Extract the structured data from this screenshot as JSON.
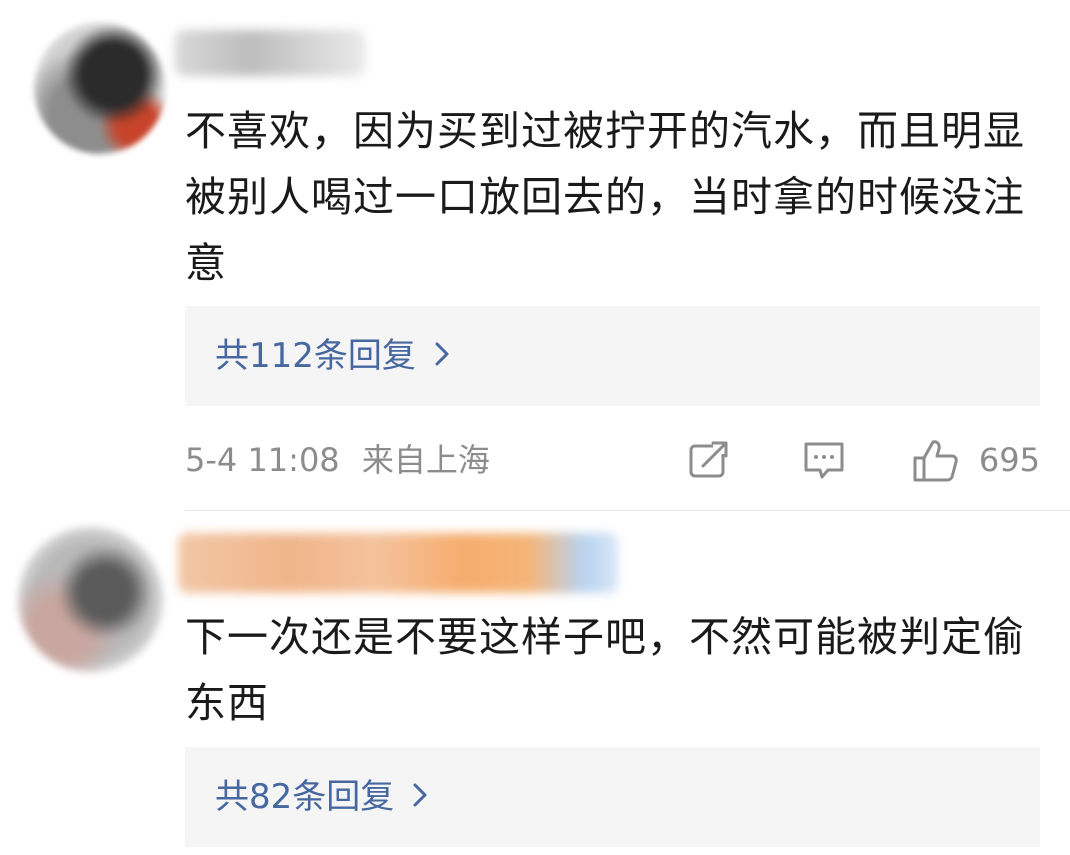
{
  "comments": [
    {
      "text": "不喜欢，因为买到过被拧开的汽水，而且明显被别人喝过一口放回去的，当时拿的时候没注意",
      "replies_label": "共112条回复",
      "timestamp": "5-4 11:08",
      "location": "来自上海",
      "likes": "695"
    },
    {
      "text": "下一次还是不要这样子吧，不然可能被判定偷东西",
      "replies_label": "共82条回复"
    }
  ],
  "icons": {
    "share": "share-icon",
    "comment": "comment-icon",
    "like": "thumbs-up-icon",
    "chevron": "chevron-right-icon"
  },
  "colors": {
    "link": "#46679f",
    "meta": "#8c8c8c",
    "text": "#1a1a1a",
    "reply_bg": "#f5f5f5"
  }
}
